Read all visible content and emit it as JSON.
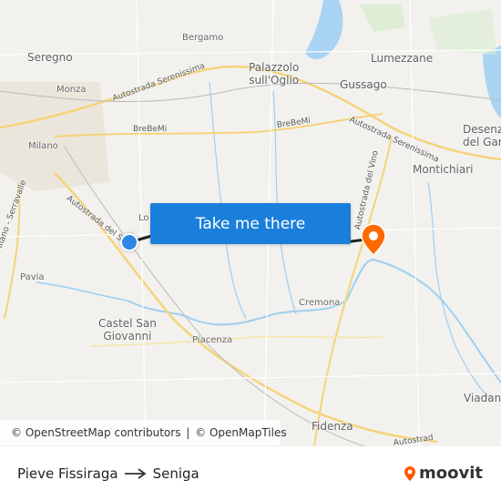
{
  "map": {
    "places": [
      {
        "name": "Bergamo",
        "cls": "place small"
      },
      {
        "name": "Seregno",
        "cls": "place"
      },
      {
        "name": "Monza",
        "cls": "place small"
      },
      {
        "name": "Palazzolo\nsull'Oglio",
        "cls": "place"
      },
      {
        "name": "Lumezzane",
        "cls": "place"
      },
      {
        "name": "Gussago",
        "cls": "place"
      },
      {
        "name": "Desenz\ndel Gar",
        "cls": "place"
      },
      {
        "name": "Milano",
        "cls": "place small"
      },
      {
        "name": "Montichiari",
        "cls": "place"
      },
      {
        "name": "Lo",
        "cls": "place small"
      },
      {
        "name": "Pavia",
        "cls": "place small"
      },
      {
        "name": "Castel San\nGiovanni",
        "cls": "place"
      },
      {
        "name": "Piacenza",
        "cls": "place small"
      },
      {
        "name": "Cremona",
        "cls": "place small"
      },
      {
        "name": "Viadana",
        "cls": "place"
      },
      {
        "name": "Fidenza",
        "cls": "place"
      }
    ],
    "roads": [
      {
        "name": "Autostrada Serenissima"
      },
      {
        "name": "BreBeMi"
      },
      {
        "name": "BreBeMi"
      },
      {
        "name": "Autostrada Serenissima"
      },
      {
        "name": "Autostrada del Vino"
      },
      {
        "name": "Autostrada del S"
      },
      {
        "name": "Milano - Serravalle"
      },
      {
        "name": "Autostrad"
      }
    ]
  },
  "cta": {
    "label": "Take me there"
  },
  "attribution": {
    "osm": "© OpenStreetMap contributors",
    "sep": " | ",
    "omt": "© OpenMapTiles"
  },
  "route": {
    "from": "Pieve Fissiraga",
    "to": "Seniga"
  },
  "brand": {
    "name": "moovit",
    "color": "#ff5a00"
  },
  "colors": {
    "accent": "#1a7fdb",
    "origin_marker": "#2f86e6",
    "destination_marker": "#ff6a00",
    "route_line": "#222222"
  },
  "icons": {
    "origin": "origin-dot-icon",
    "destination": "destination-pin-icon",
    "arrow": "arrow-right-icon",
    "brand": "moovit-pin-icon"
  }
}
